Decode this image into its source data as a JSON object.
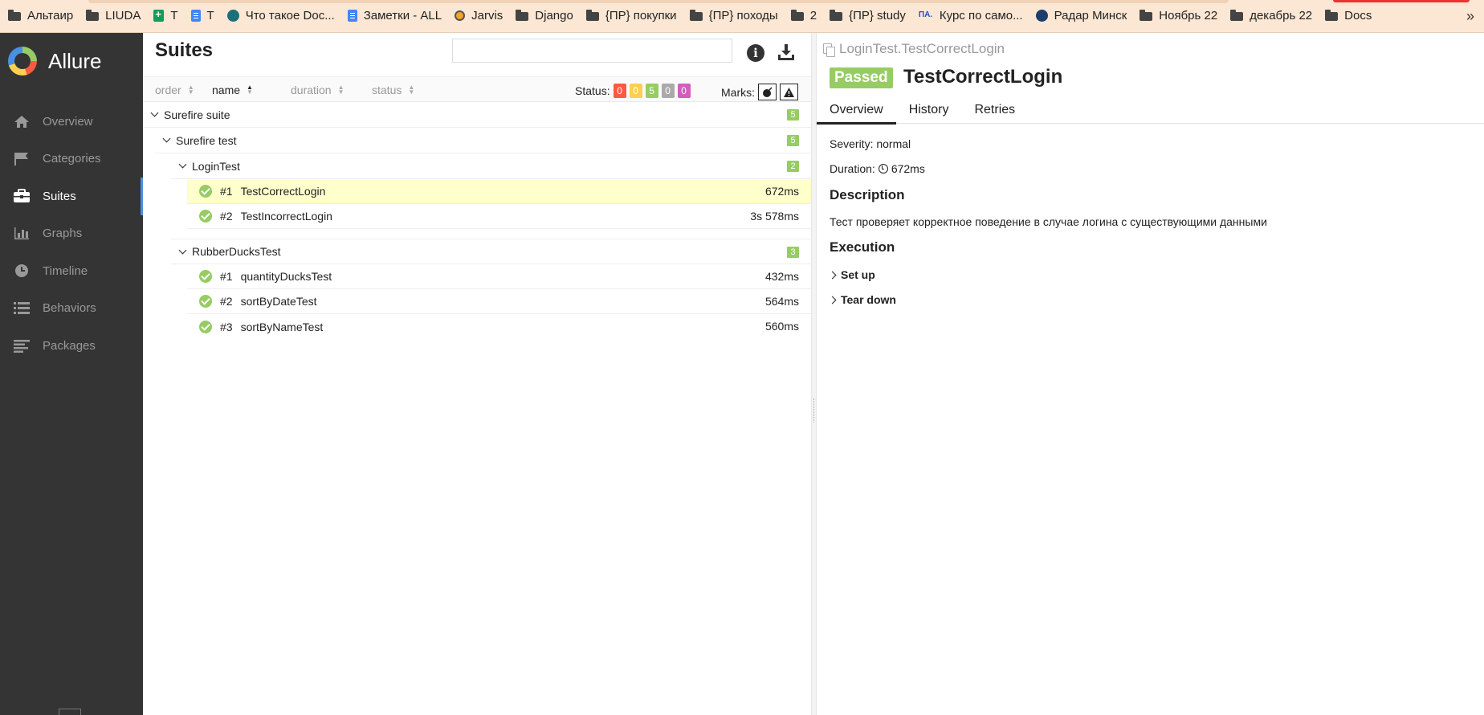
{
  "bookmarks": [
    {
      "label": "Альтаир",
      "icon": "folder-icon"
    },
    {
      "label": "LIUDA",
      "icon": "folder-icon"
    },
    {
      "label": "T",
      "icon": "sheets-icon"
    },
    {
      "label": "T",
      "icon": "docs-icon"
    },
    {
      "label": "Что такое Doc...",
      "icon": "site-icon"
    },
    {
      "label": "Заметки - ALL",
      "icon": "docs-icon"
    },
    {
      "label": "Jarvis",
      "icon": "jarvis-icon"
    },
    {
      "label": "Django",
      "icon": "folder-icon"
    },
    {
      "label": "{ПР} покупки",
      "icon": "folder-icon"
    },
    {
      "label": "{ПР} походы",
      "icon": "folder-icon"
    },
    {
      "label": "2",
      "icon": "folder-icon"
    },
    {
      "label": "{ПР} study",
      "icon": "folder-icon"
    },
    {
      "label": "Курс по само...",
      "icon": "pa-icon"
    },
    {
      "label": "Радар Минск",
      "icon": "globe-icon"
    },
    {
      "label": "Ноябрь 22",
      "icon": "folder-icon"
    },
    {
      "label": "декабрь 22",
      "icon": "folder-icon"
    },
    {
      "label": "Docs",
      "icon": "folder-icon"
    }
  ],
  "bookmarks_more": "»",
  "app": {
    "name": "Allure"
  },
  "nav": [
    {
      "label": "Overview",
      "icon": "home-icon",
      "active": false
    },
    {
      "label": "Categories",
      "icon": "flag-icon",
      "active": false
    },
    {
      "label": "Suites",
      "icon": "briefcase-icon",
      "active": true
    },
    {
      "label": "Graphs",
      "icon": "bar-chart-icon",
      "active": false
    },
    {
      "label": "Timeline",
      "icon": "clock-icon",
      "active": false
    },
    {
      "label": "Behaviors",
      "icon": "list-icon",
      "active": false
    },
    {
      "label": "Packages",
      "icon": "align-left-icon",
      "active": false
    }
  ],
  "suites": {
    "title": "Suites",
    "search_placeholder": "",
    "info_label": "i",
    "sort": {
      "order": "order",
      "name": "name",
      "duration": "duration",
      "status": "status"
    },
    "status_label": "Status:",
    "status_counts": [
      {
        "value": "0",
        "color": "#fd5a3e"
      },
      {
        "value": "0",
        "color": "#ffd050"
      },
      {
        "value": "5",
        "color": "#97cc64"
      },
      {
        "value": "0",
        "color": "#aaaaaa"
      },
      {
        "value": "0",
        "color": "#d35ebe"
      }
    ],
    "marks_label": "Marks:"
  },
  "tree": {
    "suite": {
      "name": "Surefire suite",
      "count": "5"
    },
    "test": {
      "name": "Surefire test",
      "count": "5"
    },
    "groups": [
      {
        "name": "LoginTest",
        "count": "2",
        "tests": [
          {
            "num": "#1",
            "name": "TestCorrectLogin",
            "duration": "672ms",
            "selected": true
          },
          {
            "num": "#2",
            "name": "TestIncorrectLogin",
            "duration": "3s 578ms",
            "selected": false
          }
        ]
      },
      {
        "name": "RubberDucksTest",
        "count": "3",
        "tests": [
          {
            "num": "#1",
            "name": "quantityDucksTest",
            "duration": "432ms",
            "selected": false
          },
          {
            "num": "#2",
            "name": "sortByDateTest",
            "duration": "564ms",
            "selected": false
          },
          {
            "num": "#3",
            "name": "sortByNameTest",
            "duration": "560ms",
            "selected": false
          }
        ]
      }
    ]
  },
  "detail": {
    "breadcrumb": "LoginTest.TestCorrectLogin",
    "status": "Passed",
    "title": "TestCorrectLogin",
    "tabs": [
      "Overview",
      "History",
      "Retries"
    ],
    "severity": "Severity: normal",
    "duration_label": "Duration:",
    "duration": "672ms",
    "description_heading": "Description",
    "description": "Тест проверяет корректное поведение в случае логина с существующими данными",
    "execution_heading": "Execution",
    "set_up": "Set up",
    "tear_down": "Tear down"
  }
}
